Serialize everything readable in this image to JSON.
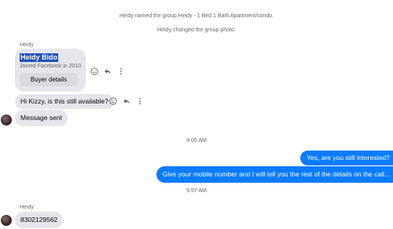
{
  "system": {
    "named_group": "Heidy named the group Heidy - 1 Bed 1 Bath Apartment/condo.",
    "changed_photo": "Heidy changed the group photo."
  },
  "thread": {
    "sender_name_1": "Heidy",
    "card": {
      "name": "Heidy Bido",
      "joined": "Joined Facebook in 2010",
      "button": "Buyer details"
    },
    "msg_in_1": "Hi Kizzy, is this still available?",
    "msg_in_2": "Message sent",
    "time_1": "9:05 AM",
    "msg_out_1": "Yes, are you still interested?",
    "msg_out_2": "Give your mobile number and I will tell you the rest of the details on the call...",
    "time_2": "9:57 AM",
    "sender_name_2": "Heidy",
    "msg_in_3": "8302129562"
  },
  "colors": {
    "outgoing_bubble": "#0a7cff",
    "incoming_bubble": "#e4e6eb",
    "meta_text": "#65676b"
  },
  "icons": [
    "smiley-icon",
    "reply-icon",
    "more-dots-icon",
    "avatar"
  ]
}
